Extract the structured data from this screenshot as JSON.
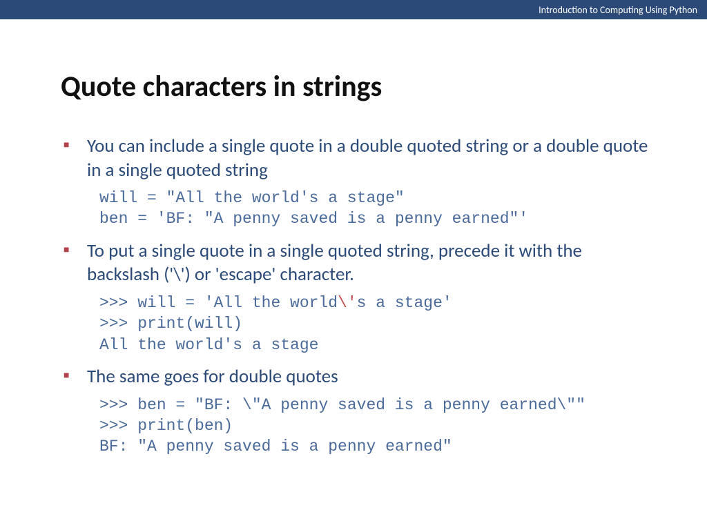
{
  "header": {
    "course": "Introduction to Computing Using Python"
  },
  "slide": {
    "title": "Quote characters in strings",
    "bullets": [
      {
        "text": "You can include a single quote in a double quoted string or a double quote in a single quoted string",
        "code_plain": "will = \"All the world's a stage\"\nben = 'BF: \"A penny saved is a penny earned\"'"
      },
      {
        "text": "To put a single quote in a single quoted string, precede it with the backslash ('\\') or 'escape' character.",
        "code_pre": ">>> will = 'All the world",
        "code_esc": "\\'",
        "code_post": "s a stage'\n>>> print(will)\nAll the world's a stage"
      },
      {
        "text": "The same goes for double quotes",
        "code_plain": ">>> ben = \"BF: \\\"A penny saved is a penny earned\\\"\"\n>>> print(ben)\nBF: \"A penny saved is a penny earned\""
      }
    ]
  }
}
